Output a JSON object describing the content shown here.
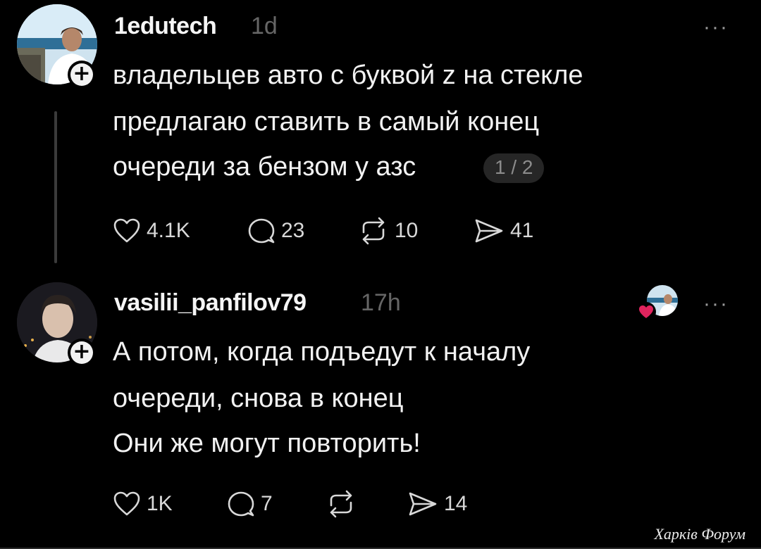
{
  "post1": {
    "username": "1edutech",
    "time": "1d",
    "text_lines": [
      "владельцев авто с буквой z на стекле",
      "предлагаю ставить в самый конец",
      "очереди за бензом у азс"
    ],
    "page_indicator": "1 / 2",
    "likes": "4.1K",
    "replies": "23",
    "reposts": "10",
    "shares": "41"
  },
  "post2": {
    "username": "vasilii_panfilov79",
    "time": "17h",
    "text_lines": [
      "А потом, когда подъедут к началу",
      "очереди, снова в конец",
      "Они же могут повторить!"
    ],
    "likes": "1K",
    "replies": "7",
    "reposts": "",
    "shares": "14"
  },
  "icons": {
    "like": "heart-icon",
    "reply": "speech-bubble-icon",
    "repost": "repost-arrows-icon",
    "share": "send-icon",
    "more": "more-dots-icon",
    "follow": "plus-icon",
    "liked_by_author": "heart-badge-icon"
  },
  "colors": {
    "background": "#000000",
    "text": "#f2f2f2",
    "muted": "#666666",
    "heart_badge": "#e0245e"
  },
  "watermark": "Харків Форум",
  "more_label": "···"
}
